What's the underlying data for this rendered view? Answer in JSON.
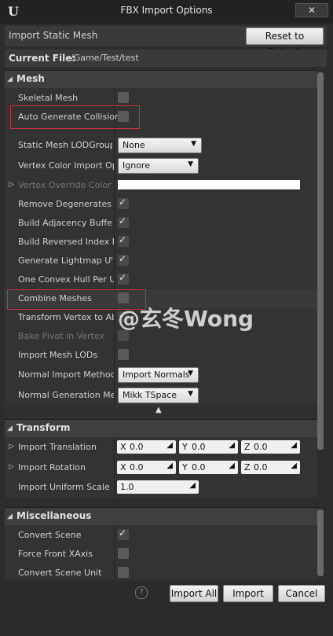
{
  "window": {
    "title": "FBX Import Options",
    "close": "✕",
    "logo": "U"
  },
  "header": {
    "mode": "Import Static Mesh",
    "reset": "Reset to Default"
  },
  "current_file": {
    "label": "Current File:",
    "value": "/Game/Test/test"
  },
  "mesh": {
    "title": "Mesh",
    "rows": [
      {
        "label": "Skeletal Mesh",
        "checked": false
      },
      {
        "label": "Auto Generate Collision",
        "checked": false
      },
      {
        "label": "Static Mesh LODGroup",
        "value": "None"
      },
      {
        "label": "Vertex Color Import Opti",
        "value": "Ignore"
      },
      {
        "label": "Vertex Override Color"
      },
      {
        "label": "Remove Degenerates",
        "checked": true
      },
      {
        "label": "Build Adjacency Buffer",
        "checked": true
      },
      {
        "label": "Build Reversed Index Bu",
        "checked": true
      },
      {
        "label": "Generate Lightmap UVs",
        "checked": true
      },
      {
        "label": "One Convex Hull Per UCX",
        "checked": true
      },
      {
        "label": "Combine Meshes",
        "checked": false
      },
      {
        "label": "Transform Vertex to Abs",
        "checked": true
      },
      {
        "label": "Bake Pivot in Vertex",
        "checked": false
      },
      {
        "label": "Import Mesh LODs",
        "checked": false
      },
      {
        "label": "Normal Import Method",
        "value": "Import Normals"
      },
      {
        "label": "Normal Generation Meth",
        "value": "Mikk TSpace"
      }
    ]
  },
  "transform": {
    "title": "Transform",
    "translation": {
      "label": "Import Translation",
      "x": "0.0",
      "y": "0.0",
      "z": "0.0"
    },
    "rotation": {
      "label": "Import Rotation",
      "x": "0.0",
      "y": "0.0",
      "z": "0.0"
    },
    "scale": {
      "label": "Import Uniform Scale",
      "value": "1.0"
    },
    "axes": {
      "x": "X",
      "y": "Y",
      "z": "Z"
    }
  },
  "misc": {
    "title": "Miscellaneous",
    "rows": [
      {
        "label": "Convert Scene",
        "checked": true
      },
      {
        "label": "Force Front XAxis",
        "checked": false
      },
      {
        "label": "Convert Scene Unit",
        "checked": false
      }
    ]
  },
  "footer": {
    "help": "?",
    "import_all": "Import All",
    "import": "Import",
    "cancel": "Cancel"
  },
  "watermark": "@玄冬Wong",
  "colors": {
    "highlight": "#c8323c",
    "background": "#2d2d2d"
  }
}
